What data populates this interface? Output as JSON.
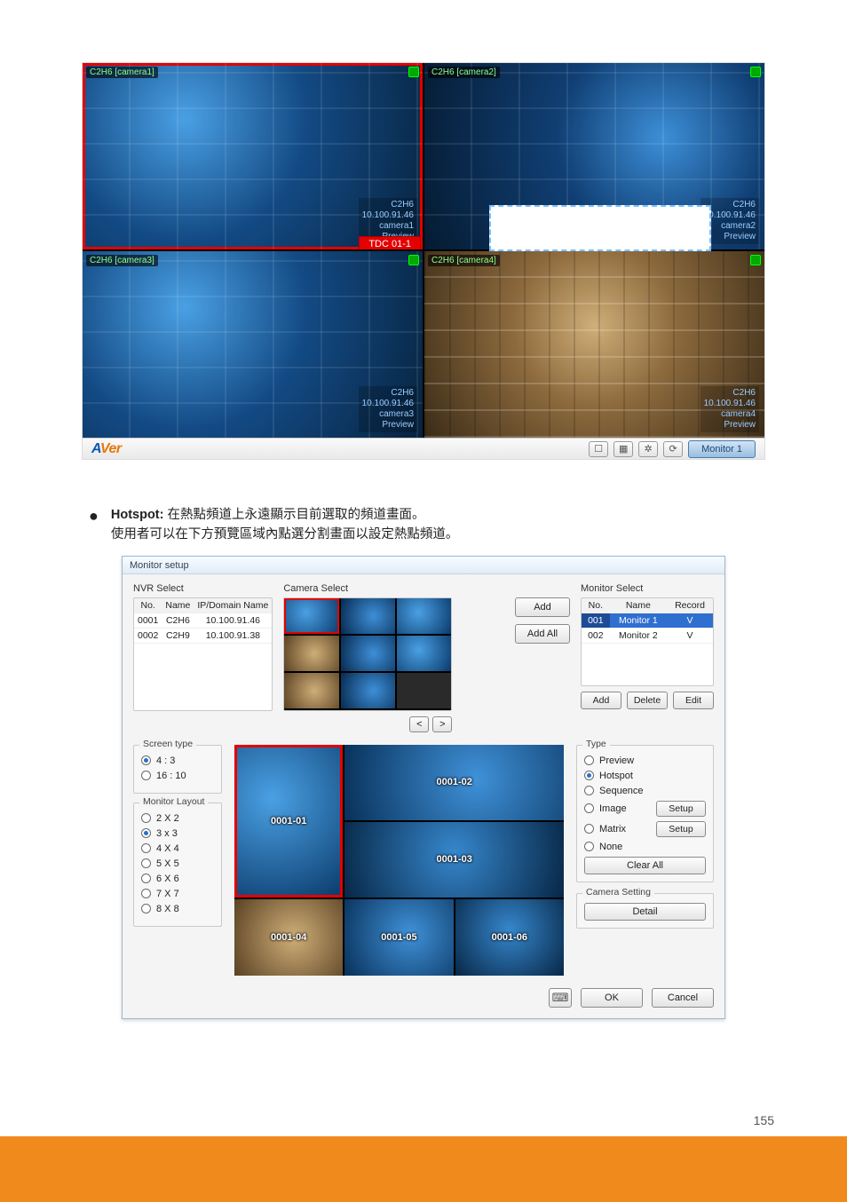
{
  "preview": {
    "feed1": {
      "label": "C2H6 [camera1]",
      "name": "C2H6",
      "ip": "10.100.91.46",
      "cam": "camera1",
      "mode": "Preview",
      "ptz": "TDC 01-1"
    },
    "feed2": {
      "label": "C2H6 [camera2]",
      "name": "C2H6",
      "ip": "10.100.91.46",
      "cam": "camera2",
      "mode": "Preview"
    },
    "feed3": {
      "label": "C2H6 [camera3]",
      "name": "C2H6",
      "ip": "10.100.91.46",
      "cam": "camera3",
      "mode": "Preview"
    },
    "feed4": {
      "label": "C2H6 [camera4]",
      "name": "C2H6",
      "ip": "10.100.91.46",
      "cam": "camera4",
      "mode": "Preview"
    },
    "brand_a": "A",
    "brand_v": "Ver",
    "monitor_pill": "Monitor 1"
  },
  "desc": {
    "bullet1_bold": "Hotspot:",
    "bullet1_rest": " 在熱點頻道上永遠顯示目前選取的頻道畫面。",
    "bullet1_line2": "使用者可以在下方預覽區域內點選分割畫面以設定熱點頻道。"
  },
  "dialog": {
    "title": "Monitor setup",
    "nvr": {
      "label": "NVR Select",
      "headers": {
        "no": "No.",
        "name": "Name",
        "ip": "IP/Domain Name"
      },
      "rows": [
        {
          "no": "0001",
          "name": "C2H6",
          "ip": "10.100.91.46"
        },
        {
          "no": "0002",
          "name": "C2H9",
          "ip": "10.100.91.38"
        }
      ]
    },
    "camselect": {
      "label": "Camera Select",
      "add": "Add",
      "addall": "Add All",
      "prev": "<",
      "next": ">"
    },
    "monselect": {
      "label": "Monitor Select",
      "headers": {
        "no": "No.",
        "name": "Name",
        "record": "Record"
      },
      "rows": [
        {
          "no": "001",
          "name": "Monitor 1",
          "record": "V",
          "sel": true
        },
        {
          "no": "002",
          "name": "Monitor 2",
          "record": "V",
          "sel": false
        }
      ],
      "add": "Add",
      "delete": "Delete",
      "edit": "Edit"
    },
    "screentype": {
      "legend": "Screen type",
      "o1": "4 : 3",
      "o2": "16 : 10",
      "selected": "4 : 3"
    },
    "layout": {
      "legend": "Monitor Layout",
      "opts": [
        "2 X 2",
        "3 x 3",
        "4 X 4",
        "5 X 5",
        "6 X 6",
        "7 X 7",
        "8 X 8"
      ],
      "selected": "3 x 3"
    },
    "grid": {
      "ids": [
        "0001-01",
        "0001-02",
        "0001-03",
        "0001-04",
        "0001-05",
        "0001-06"
      ]
    },
    "type": {
      "legend": "Type",
      "preview": "Preview",
      "hotspot": "Hotspot",
      "sequence": "Sequence",
      "image": "Image",
      "matrix": "Matrix",
      "none": "None",
      "setup": "Setup",
      "clearall": "Clear All",
      "selected": "Hotspot"
    },
    "camsetting": {
      "legend": "Camera Setting",
      "detail": "Detail"
    },
    "footer": {
      "ok": "OK",
      "cancel": "Cancel"
    }
  },
  "page_number": "155"
}
